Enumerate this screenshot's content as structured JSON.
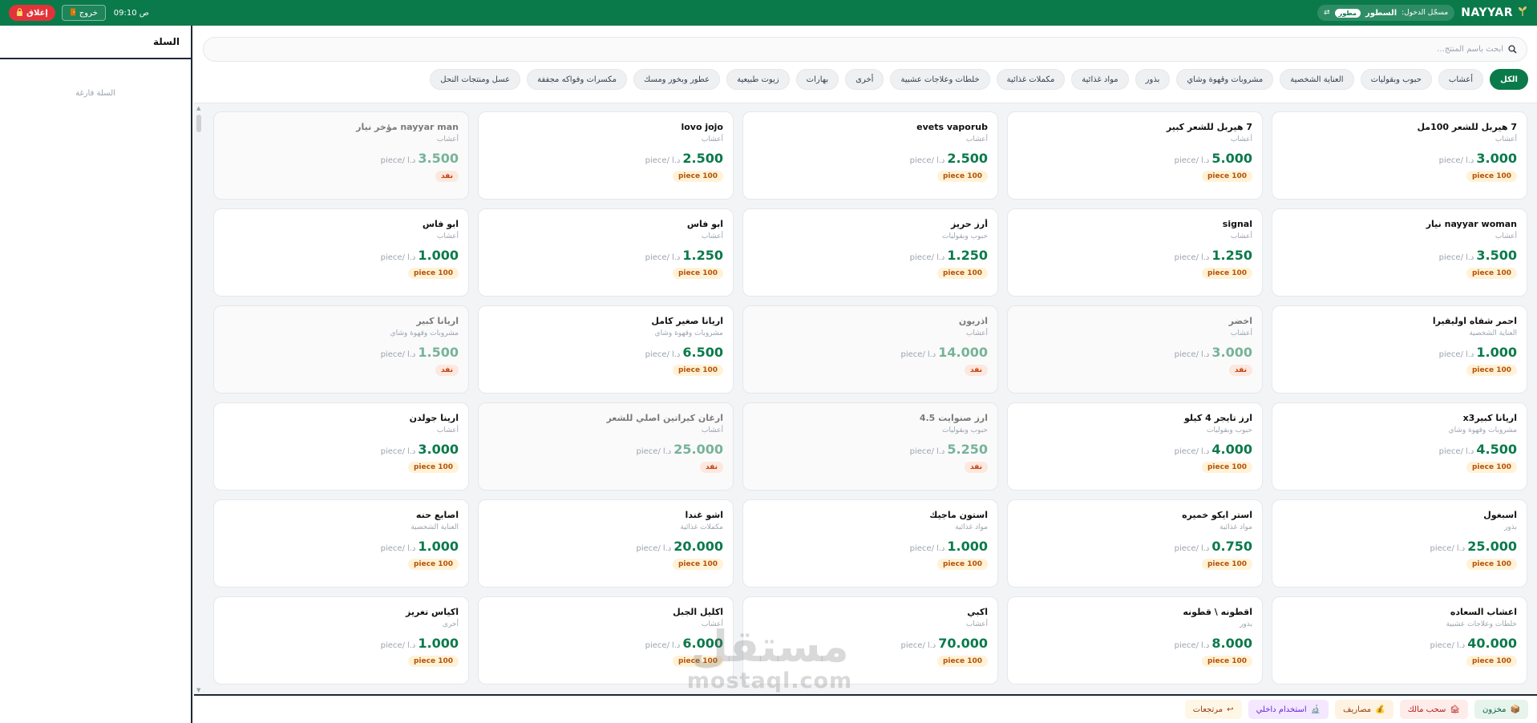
{
  "topbar": {
    "close_label": "إغلاق",
    "logout_label": "خروج",
    "time": "09:10 ص",
    "user_prefix": "مسجّل الدخول:",
    "user_name": "السطور",
    "role": "مطور",
    "brand": "NAYYAR"
  },
  "cart": {
    "title": "السلة",
    "empty": "السلة فارغة"
  },
  "search": {
    "placeholder": "ابحث باسم المنتج..."
  },
  "categories": [
    "الكل",
    "أعشاب",
    "حبوب وبقوليات",
    "العناية الشخصية",
    "مشروبات وقهوة وشاي",
    "بذور",
    "مواد غذائية",
    "مكملات غذائية",
    "خلطات وعلاجات عشبية",
    "أخرى",
    "بهارات",
    "زيوت طبيعية",
    "عطور وبخور ومسك",
    "مكسرات وفواكه مجففة",
    "عسل ومنتجات النحل"
  ],
  "currency": "د.ا",
  "unit_suffix": "/piece",
  "products": [
    {
      "name": "7 هيربل للشعر 100مل",
      "category": "أعشاب",
      "price": "3.000",
      "stock": "100 piece",
      "available": true
    },
    {
      "name": "7 هيربل للشعر كبير",
      "category": "أعشاب",
      "price": "5.000",
      "stock": "100 piece",
      "available": true
    },
    {
      "name": "evets vaporub",
      "category": "أعشاب",
      "price": "2.500",
      "stock": "100 piece",
      "available": true
    },
    {
      "name": "lovo jojo",
      "category": "أعشاب",
      "price": "2.500",
      "stock": "100 piece",
      "available": true
    },
    {
      "name": "nayyar man مؤخر نيار",
      "category": "أعشاب",
      "price": "3.500",
      "stock": "نفد",
      "available": false
    },
    {
      "name": "nayyar woman نيار",
      "category": "أعشاب",
      "price": "3.500",
      "stock": "100 piece",
      "available": true
    },
    {
      "name": "signal",
      "category": "أعشاب",
      "price": "1.250",
      "stock": "100 piece",
      "available": true
    },
    {
      "name": "أرز حريز",
      "category": "حبوب وبقوليات",
      "price": "1.250",
      "stock": "100 piece",
      "available": true
    },
    {
      "name": "ابو فاس",
      "category": "أعشاب",
      "price": "1.250",
      "stock": "100 piece",
      "available": true
    },
    {
      "name": "ابو فاس",
      "category": "أعشاب",
      "price": "1.000",
      "stock": "100 piece",
      "available": true
    },
    {
      "name": "احمر شفاه اوليفيرا",
      "category": "العناية الشخصية",
      "price": "1.000",
      "stock": "100 piece",
      "available": true
    },
    {
      "name": "اخضر",
      "category": "أعشاب",
      "price": "3.000",
      "stock": "نفد",
      "available": false
    },
    {
      "name": "اذريون",
      "category": "أعشاب",
      "price": "14.000",
      "stock": "نفد",
      "available": false
    },
    {
      "name": "اريانا صغير كامل",
      "category": "مشروبات وقهوة وشاي",
      "price": "6.500",
      "stock": "100 piece",
      "available": true
    },
    {
      "name": "اريانا كبير",
      "category": "مشروبات وقهوة وشاي",
      "price": "1.500",
      "stock": "نفد",
      "available": false
    },
    {
      "name": "اريانا كبيرx3",
      "category": "مشروبات وقهوة وشاي",
      "price": "4.500",
      "stock": "100 piece",
      "available": true
    },
    {
      "name": "ارز تايجر 4 كيلو",
      "category": "حبوب وبقوليات",
      "price": "4.000",
      "stock": "100 piece",
      "available": true
    },
    {
      "name": "ارز صنوايت 4.5",
      "category": "حبوب وبقوليات",
      "price": "5.250",
      "stock": "نفد",
      "available": false
    },
    {
      "name": "ارغان كيراتين اصلي للشعر",
      "category": "أعشاب",
      "price": "25.000",
      "stock": "نفد",
      "available": false
    },
    {
      "name": "ارينا جولدن",
      "category": "أعشاب",
      "price": "3.000",
      "stock": "100 piece",
      "available": true
    },
    {
      "name": "اسبغول",
      "category": "بذور",
      "price": "25.000",
      "stock": "100 piece",
      "available": true
    },
    {
      "name": "استر ايكو خميره",
      "category": "مواد غذائية",
      "price": "0.750",
      "stock": "100 piece",
      "available": true
    },
    {
      "name": "استون ماجيك",
      "category": "مواد غذائية",
      "price": "1.000",
      "stock": "100 piece",
      "available": true
    },
    {
      "name": "اشو غندا",
      "category": "مكملات غذائية",
      "price": "20.000",
      "stock": "100 piece",
      "available": true
    },
    {
      "name": "اصابع حنه",
      "category": "العناية الشخصية",
      "price": "1.000",
      "stock": "100 piece",
      "available": true
    },
    {
      "name": "اعشاب السعاده",
      "category": "خلطات وعلاجات عشبية",
      "price": "40.000",
      "stock": "100 piece",
      "available": true
    },
    {
      "name": "اقطونه \\ قطونه",
      "category": "بذور",
      "price": "8.000",
      "stock": "100 piece",
      "available": true
    },
    {
      "name": "اكبي",
      "category": "أعشاب",
      "price": "70.000",
      "stock": "100 piece",
      "available": true
    },
    {
      "name": "اكليل الجبل",
      "category": "أعشاب",
      "price": "6.000",
      "stock": "100 piece",
      "available": true
    },
    {
      "name": "اكياس تغريز",
      "category": "أخرى",
      "price": "1.000",
      "stock": "100 piece",
      "available": true
    }
  ],
  "bottombar": {
    "inventory": "مخزون",
    "withdraw": "سحب مالك",
    "expenses": "مصاريف",
    "internal_use": "استخدام داخلي",
    "returns": "مرتجعات"
  },
  "watermark": {
    "ar": "مستقل",
    "en": "mostaql.com"
  }
}
